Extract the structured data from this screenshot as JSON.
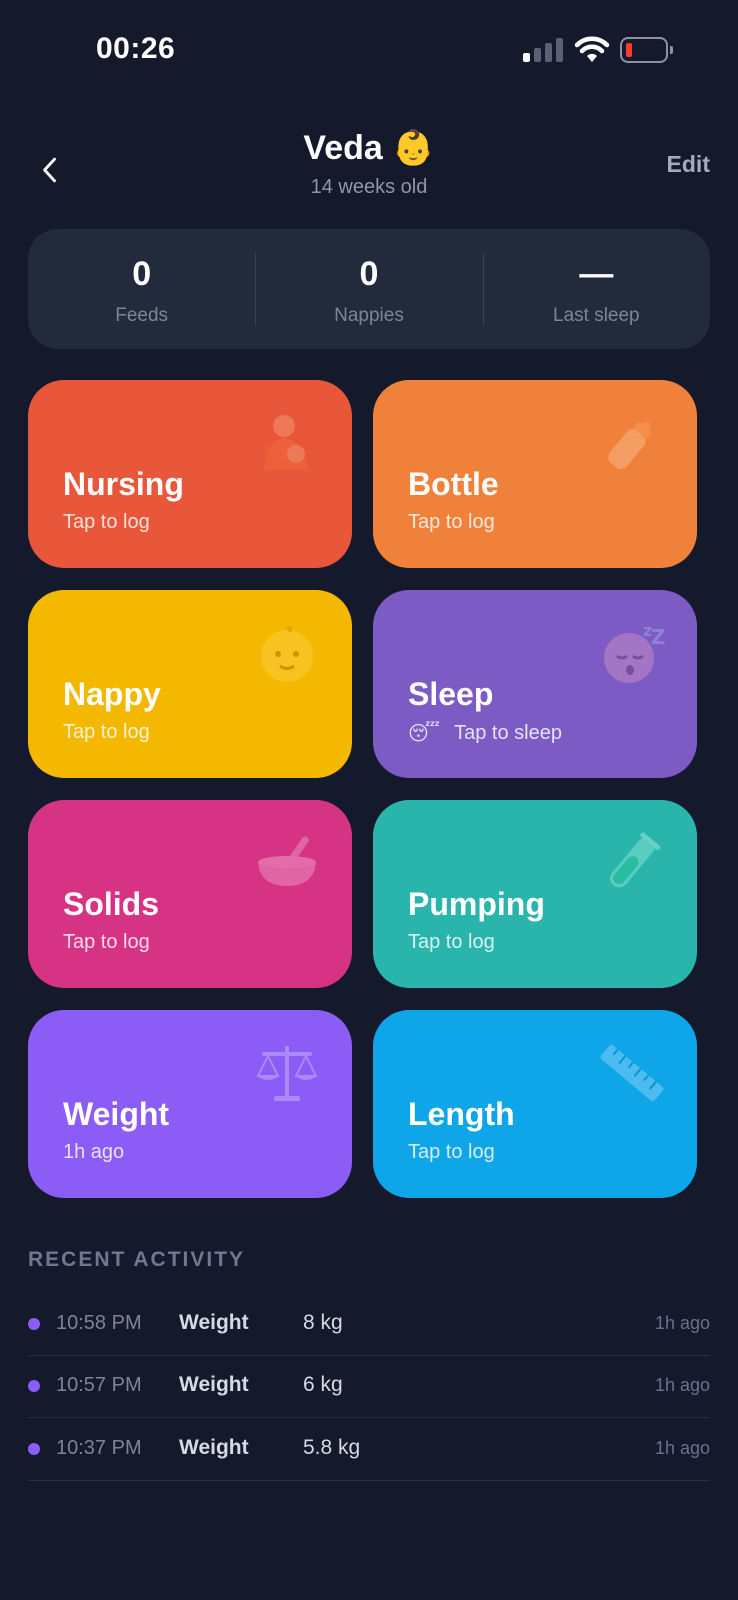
{
  "status_bar": {
    "time": "00:26"
  },
  "header": {
    "title": "Veda 👶",
    "subtitle": "14 weeks old",
    "edit_label": "Edit"
  },
  "summary": [
    {
      "value": "0",
      "label": "Feeds"
    },
    {
      "value": "0",
      "label": "Nappies"
    },
    {
      "value": "—",
      "label": "Last sleep"
    }
  ],
  "tiles": [
    {
      "title": "Nursing",
      "subtitle": "Tap to log",
      "color": "#e8573a",
      "icon": "nursing-icon"
    },
    {
      "title": "Bottle",
      "subtitle": "Tap to log",
      "color": "#f0813a",
      "icon": "bottle-icon"
    },
    {
      "title": "Nappy",
      "subtitle": "Tap to log",
      "color": "#f5b800",
      "icon": "baby-face-icon"
    },
    {
      "title": "Sleep",
      "subtitle": "Tap to sleep",
      "subtitle_emoji": "😴",
      "color": "#7c5cc4",
      "icon": "sleeping-face-icon"
    },
    {
      "title": "Solids",
      "subtitle": "Tap to log",
      "color": "#d63384",
      "icon": "bowl-icon"
    },
    {
      "title": "Pumping",
      "subtitle": "Tap to log",
      "color": "#2ab5ac",
      "icon": "test-tube-icon"
    },
    {
      "title": "Weight",
      "subtitle": "1h ago",
      "color": "#8b5cf6",
      "icon": "scale-icon"
    },
    {
      "title": "Length",
      "subtitle": "Tap to log",
      "color": "#0ea5e9",
      "icon": "ruler-icon"
    }
  ],
  "recent_activity": {
    "title": "RECENT ACTIVITY",
    "items": [
      {
        "time": "10:58 PM",
        "type": "Weight",
        "value": "8 kg",
        "ago": "1h ago",
        "dot_color": "#8b5cf6"
      },
      {
        "time": "10:57 PM",
        "type": "Weight",
        "value": "6 kg",
        "ago": "1h ago",
        "dot_color": "#8b5cf6"
      },
      {
        "time": "10:37 PM",
        "type": "Weight",
        "value": "5.8 kg",
        "ago": "1h ago",
        "dot_color": "#8b5cf6"
      }
    ]
  }
}
